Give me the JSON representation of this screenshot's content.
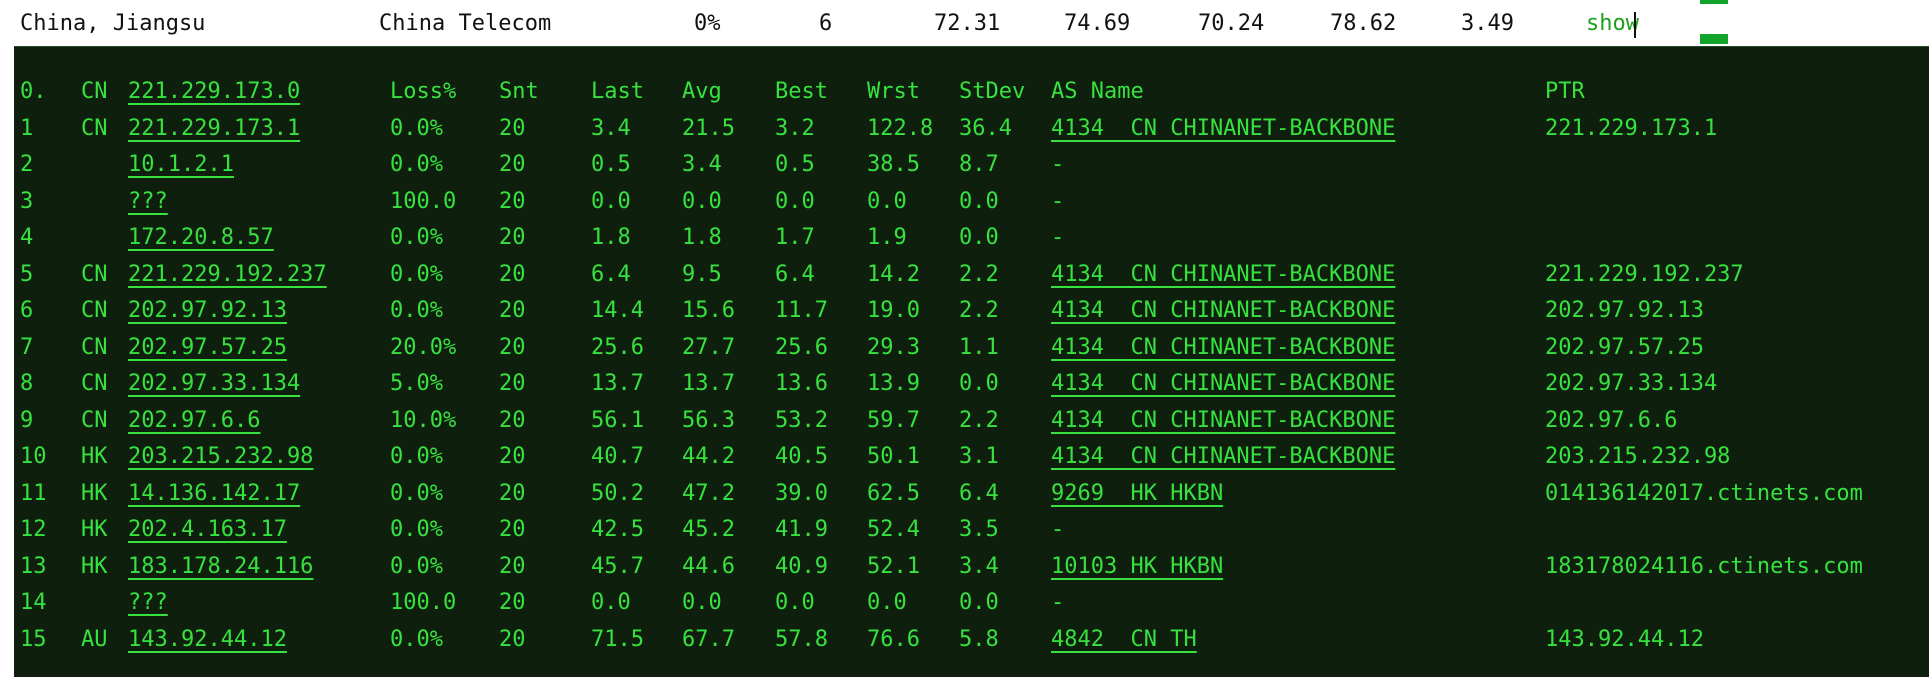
{
  "summary_row": {
    "location": "China, Jiangsu",
    "isp": "China Telecom",
    "loss": "0%",
    "sent": "6",
    "last": "72.31",
    "avg": "74.69",
    "best": "70.24",
    "worst": "78.62",
    "stdev": "3.49",
    "action_label": "show"
  },
  "trace": {
    "header": {
      "hop": "0.",
      "cc": "CN",
      "host": "221.229.173.0",
      "loss": "Loss%",
      "snt": "Snt",
      "last": "Last",
      "avg": "Avg",
      "best": "Best",
      "wrst": "Wrst",
      "stdev": "StDev",
      "asname": "AS Name",
      "ptr": "PTR"
    },
    "rows": [
      {
        "hop": "1",
        "cc": "CN",
        "host": "221.229.173.1",
        "loss": "0.0%",
        "snt": "20",
        "last": "3.4",
        "avg": "21.5",
        "best": "3.2",
        "wrst": "122.8",
        "stdev": "36.4",
        "asname": "4134  CN CHINANET-BACKBONE",
        "ptr": "221.229.173.1"
      },
      {
        "hop": "2",
        "cc": "",
        "host": "10.1.2.1",
        "loss": "0.0%",
        "snt": "20",
        "last": "0.5",
        "avg": "3.4",
        "best": "0.5",
        "wrst": "38.5",
        "stdev": "8.7",
        "asname": "-",
        "ptr": ""
      },
      {
        "hop": "3",
        "cc": "",
        "host": "???",
        "loss": "100.0",
        "snt": "20",
        "last": "0.0",
        "avg": "0.0",
        "best": "0.0",
        "wrst": "0.0",
        "stdev": "0.0",
        "asname": "-",
        "ptr": ""
      },
      {
        "hop": "4",
        "cc": "",
        "host": "172.20.8.57",
        "loss": "0.0%",
        "snt": "20",
        "last": "1.8",
        "avg": "1.8",
        "best": "1.7",
        "wrst": "1.9",
        "stdev": "0.0",
        "asname": "-",
        "ptr": ""
      },
      {
        "hop": "5",
        "cc": "CN",
        "host": "221.229.192.237",
        "loss": "0.0%",
        "snt": "20",
        "last": "6.4",
        "avg": "9.5",
        "best": "6.4",
        "wrst": "14.2",
        "stdev": "2.2",
        "asname": "4134  CN CHINANET-BACKBONE",
        "ptr": "221.229.192.237"
      },
      {
        "hop": "6",
        "cc": "CN",
        "host": "202.97.92.13",
        "loss": "0.0%",
        "snt": "20",
        "last": "14.4",
        "avg": "15.6",
        "best": "11.7",
        "wrst": "19.0",
        "stdev": "2.2",
        "asname": "4134  CN CHINANET-BACKBONE",
        "ptr": "202.97.92.13"
      },
      {
        "hop": "7",
        "cc": "CN",
        "host": "202.97.57.25",
        "loss": "20.0%",
        "snt": "20",
        "last": "25.6",
        "avg": "27.7",
        "best": "25.6",
        "wrst": "29.3",
        "stdev": "1.1",
        "asname": "4134  CN CHINANET-BACKBONE",
        "ptr": "202.97.57.25"
      },
      {
        "hop": "8",
        "cc": "CN",
        "host": "202.97.33.134",
        "loss": "5.0%",
        "snt": "20",
        "last": "13.7",
        "avg": "13.7",
        "best": "13.6",
        "wrst": "13.9",
        "stdev": "0.0",
        "asname": "4134  CN CHINANET-BACKBONE",
        "ptr": "202.97.33.134"
      },
      {
        "hop": "9",
        "cc": "CN",
        "host": "202.97.6.6",
        "loss": "10.0%",
        "snt": "20",
        "last": "56.1",
        "avg": "56.3",
        "best": "53.2",
        "wrst": "59.7",
        "stdev": "2.2",
        "asname": "4134  CN CHINANET-BACKBONE",
        "ptr": "202.97.6.6"
      },
      {
        "hop": "10",
        "cc": "HK",
        "host": "203.215.232.98",
        "loss": "0.0%",
        "snt": "20",
        "last": "40.7",
        "avg": "44.2",
        "best": "40.5",
        "wrst": "50.1",
        "stdev": "3.1",
        "asname": "4134  CN CHINANET-BACKBONE",
        "ptr": "203.215.232.98"
      },
      {
        "hop": "11",
        "cc": "HK",
        "host": "14.136.142.17",
        "loss": "0.0%",
        "snt": "20",
        "last": "50.2",
        "avg": "47.2",
        "best": "39.0",
        "wrst": "62.5",
        "stdev": "6.4",
        "asname": "9269  HK HKBN",
        "ptr": "014136142017.ctinets.com"
      },
      {
        "hop": "12",
        "cc": "HK",
        "host": "202.4.163.17",
        "loss": "0.0%",
        "snt": "20",
        "last": "42.5",
        "avg": "45.2",
        "best": "41.9",
        "wrst": "52.4",
        "stdev": "3.5",
        "asname": "-",
        "ptr": ""
      },
      {
        "hop": "13",
        "cc": "HK",
        "host": "183.178.24.116",
        "loss": "0.0%",
        "snt": "20",
        "last": "45.7",
        "avg": "44.6",
        "best": "40.9",
        "wrst": "52.1",
        "stdev": "3.4",
        "asname": "10103 HK HKBN",
        "ptr": "183178024116.ctinets.com"
      },
      {
        "hop": "14",
        "cc": "",
        "host": "???",
        "loss": "100.0",
        "snt": "20",
        "last": "0.0",
        "avg": "0.0",
        "best": "0.0",
        "wrst": "0.0",
        "stdev": "0.0",
        "asname": "-",
        "ptr": ""
      },
      {
        "hop": "15",
        "cc": "AU",
        "host": "143.92.44.12",
        "loss": "0.0%",
        "snt": "20",
        "last": "71.5",
        "avg": "67.7",
        "best": "57.8",
        "wrst": "76.6",
        "stdev": "5.8",
        "asname": "4842  CN TH",
        "ptr": "143.92.44.12"
      }
    ]
  },
  "colors": {
    "terminal_bg": "#0e1f0e",
    "terminal_text": "#37e23f",
    "indicator": "#11a32a"
  }
}
